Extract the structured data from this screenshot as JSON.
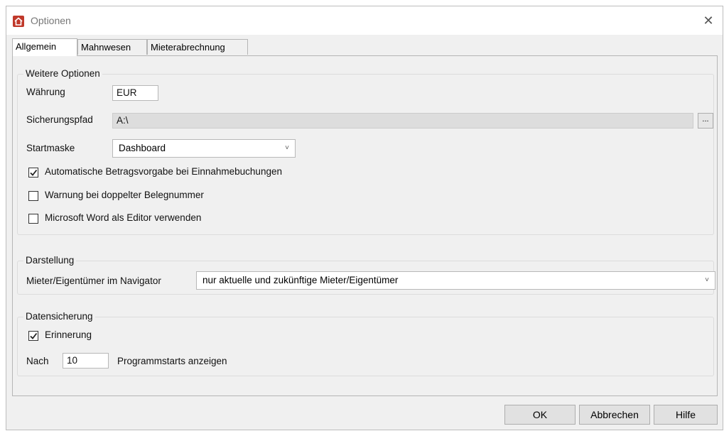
{
  "window": {
    "title": "Optionen"
  },
  "tabs": [
    {
      "label": "Allgemein",
      "active": true
    },
    {
      "label": "Mahnwesen",
      "active": false
    },
    {
      "label": "Mieterabrechnung",
      "active": false
    }
  ],
  "weitere_optionen": {
    "title": "Weitere Optionen",
    "waehrung_label": "Währung",
    "waehrung_value": "EUR",
    "sicherungspfad_label": "Sicherungspfad",
    "sicherungspfad_value": "A:\\",
    "browse_label": "...",
    "startmaske_label": "Startmaske",
    "startmaske_value": "Dashboard",
    "checkboxes": [
      {
        "label": "Automatische Betragsvorgabe bei Einnahmebuchungen",
        "checked": true
      },
      {
        "label": "Warnung bei doppelter Belegnummer",
        "checked": false
      },
      {
        "label": "Microsoft Word als Editor verwenden",
        "checked": false
      }
    ]
  },
  "darstellung": {
    "title": "Darstellung",
    "navigator_label": "Mieter/Eigentümer im Navigator",
    "navigator_value": "nur aktuelle und zukünftige Mieter/Eigentümer"
  },
  "datensicherung": {
    "title": "Datensicherung",
    "erinnerung_label": "Erinnerung",
    "erinnerung_checked": true,
    "nach_label": "Nach",
    "nach_value": "10",
    "programmstarts_label": "Programmstarts anzeigen"
  },
  "buttons": {
    "ok": "OK",
    "cancel": "Abbrechen",
    "help": "Hilfe"
  },
  "colors": {
    "app_icon": "#c0392b",
    "dialog_bg": "#f0f0f0"
  },
  "icons": {
    "app": "house-icon",
    "close": "close-icon",
    "dropdown": "chevron-down-icon",
    "check": "checkmark-icon"
  }
}
